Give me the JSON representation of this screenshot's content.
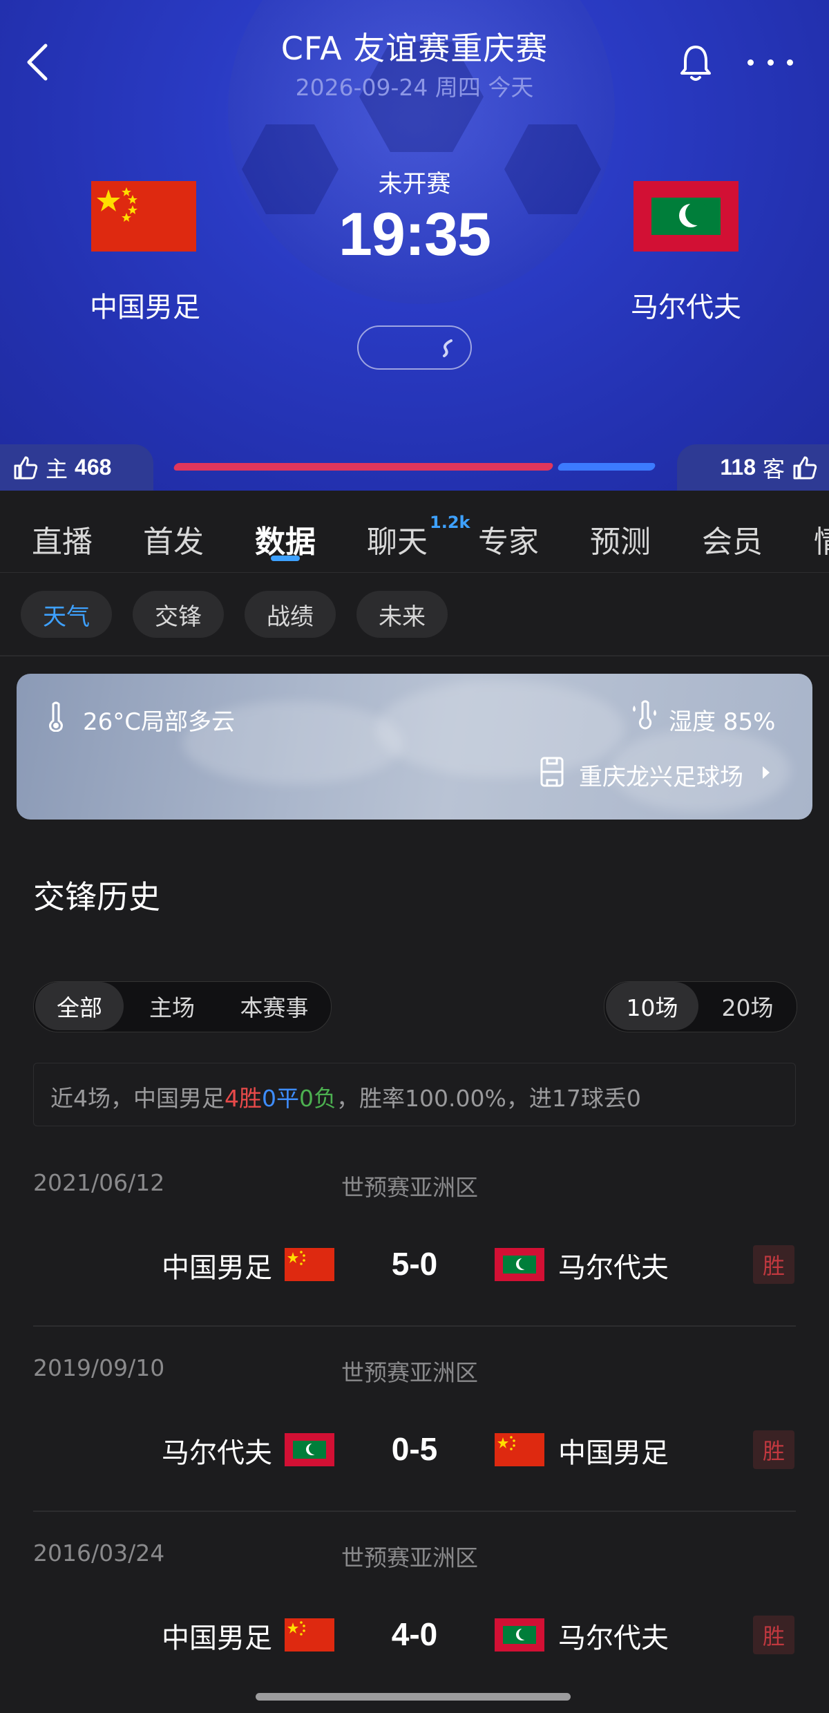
{
  "header": {
    "title": "CFA 友谊赛重庆赛",
    "date": "2026-09-24 周四 今天",
    "status": "未开赛",
    "kickoff": "19:35"
  },
  "teams": {
    "home": {
      "name": "中国男足",
      "flag": "china-flag"
    },
    "away": {
      "name": "马尔代夫",
      "flag": "maldives-flag"
    }
  },
  "votes": {
    "home_label": "主",
    "home_count": "468",
    "away_label": "客",
    "away_count": "118"
  },
  "tabs": [
    {
      "label": "直播"
    },
    {
      "label": "首发"
    },
    {
      "label": "数据"
    },
    {
      "label": "聊天"
    },
    {
      "label": "专家"
    },
    {
      "label": "预测"
    },
    {
      "label": "会员"
    },
    {
      "label": "情"
    }
  ],
  "chat_badge": "1.2k",
  "subtabs": [
    {
      "label": "天气"
    },
    {
      "label": "交锋"
    },
    {
      "label": "战绩"
    },
    {
      "label": "未来"
    }
  ],
  "weather": {
    "temp": "26°C局部多云",
    "humidity": "湿度 85%",
    "venue": "重庆龙兴足球场"
  },
  "history": {
    "title": "交锋历史",
    "filters": [
      "全部",
      "主场",
      "本赛事"
    ],
    "counts": [
      "10场",
      "20场"
    ],
    "summary": {
      "prefix": "近4场，中国男足",
      "wins": "4胜",
      "draws": "0平",
      "losses": "0负",
      "suffix": "，胜率100.00%，进17球丢0"
    },
    "matches": [
      {
        "date": "2021/06/12",
        "competition": "世预赛亚洲区",
        "home": "中国男足",
        "home_flag": "cn",
        "score": "5-0",
        "away": "马尔代夫",
        "away_flag": "mv",
        "result": "胜"
      },
      {
        "date": "2019/09/10",
        "competition": "世预赛亚洲区",
        "home": "马尔代夫",
        "home_flag": "mv",
        "score": "0-5",
        "away": "中国男足",
        "away_flag": "cn",
        "result": "胜"
      },
      {
        "date": "2016/03/24",
        "competition": "世预赛亚洲区",
        "home": "中国男足",
        "home_flag": "cn",
        "score": "4-0",
        "away": "马尔代夫",
        "away_flag": "mv",
        "result": "胜"
      }
    ]
  },
  "colors": {
    "header_blue": "#2a3bc4",
    "accent_blue": "#3ea1ff",
    "home_bar": "#e0365c",
    "away_bar": "#3c7bff",
    "win": "#c0383f"
  }
}
